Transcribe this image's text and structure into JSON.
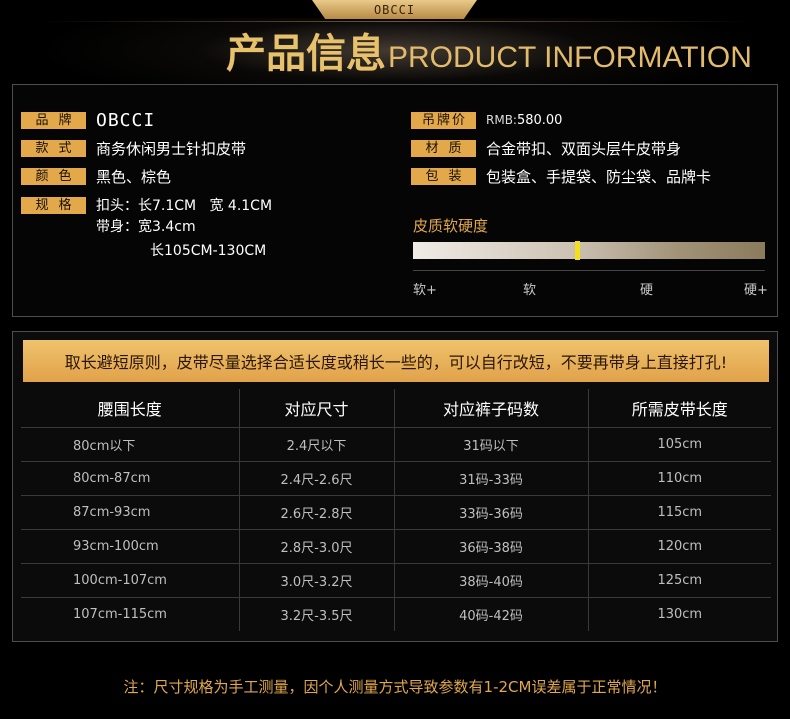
{
  "header": {
    "top_tab": "OBCCI",
    "title_cn": "产品信息",
    "title_en": "PRODUCT INFORMATION"
  },
  "info": {
    "left": [
      {
        "label": "品牌",
        "value": "OBCCI"
      },
      {
        "label": "款式",
        "value": "商务休闲男士针扣皮带"
      },
      {
        "label": "颜色",
        "value": "黑色、棕色"
      },
      {
        "label": "规格",
        "value": "扣头：长7.1CM   宽 4.1CM"
      }
    ],
    "spec_line2": "带身：宽3.4cm",
    "spec_line3": "长105CM-130CM",
    "right": [
      {
        "label": "吊牌价",
        "value": ""
      },
      {
        "label": "材质",
        "value": "合金带扣、双面头层牛皮带身"
      },
      {
        "label": "包装",
        "value": "包装盒、手提袋、防尘袋、品牌卡"
      }
    ],
    "price_prefix": "RMB:",
    "price_value": "580.00",
    "hardness": {
      "title": "皮质软硬度",
      "level": 0.46,
      "labels": [
        "软+",
        "软",
        "硬",
        "硬+"
      ]
    }
  },
  "size_table": {
    "notice": "取长避短原则，皮带尽量选择合适长度或稍长一些的，可以自行改短，不要再带身上直接打孔!",
    "headers": [
      "腰围长度",
      "对应尺寸",
      "对应裤子码数",
      "所需皮带长度"
    ],
    "rows": [
      [
        "80cm以下",
        "2.4尺以下",
        "31码以下",
        "105cm"
      ],
      [
        "80cm-87cm",
        "2.4尺-2.6尺",
        "31码-33码",
        "110cm"
      ],
      [
        "87cm-93cm",
        "2.6尺-2.8尺",
        "33码-36码",
        "115cm"
      ],
      [
        "93cm-100cm",
        "2.8尺-3.0尺",
        "36码-38码",
        "120cm"
      ],
      [
        "100cm-107cm",
        "3.0尺-3.2尺",
        "38码-40码",
        "125cm"
      ],
      [
        "107cm-115cm",
        "3.2尺-3.5尺",
        "40码-42码",
        "130cm"
      ]
    ]
  },
  "footer": {
    "note": "注：尺寸规格为手工测量，因个人测量方式导致参数有1-2CM误差属于正常情况！"
  },
  "colors": {
    "gold": "#e2a84a",
    "title_gold": "#e8c16c",
    "marker": "#f4e01a"
  }
}
